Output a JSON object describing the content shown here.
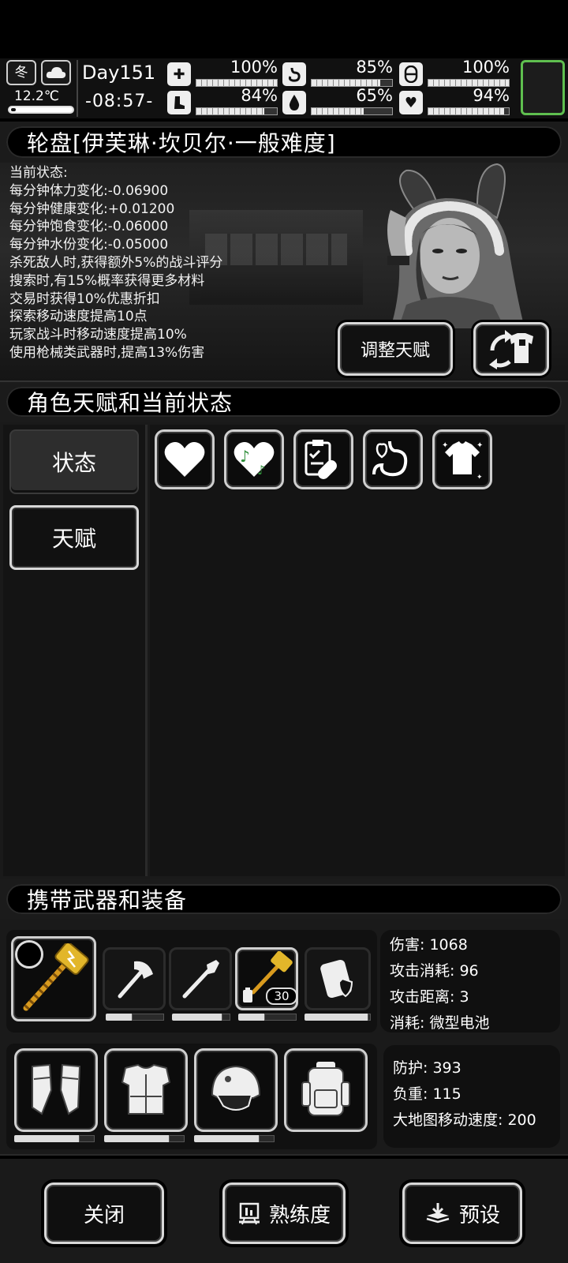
{
  "hud": {
    "season": "冬",
    "weather_icon": "cloud-icon",
    "temperature": "12.2℃",
    "day": "Day151",
    "time": "-08:57-",
    "stats": [
      {
        "name": "health",
        "icon": "medkit-icon",
        "value_text": "100%",
        "value": 100
      },
      {
        "name": "hunger",
        "icon": "stomach-icon",
        "value_text": "85%",
        "value": 85
      },
      {
        "name": "energy",
        "icon": "capsule-icon",
        "value_text": "100%",
        "value": 100
      },
      {
        "name": "stamina",
        "icon": "boot-icon",
        "value_text": "84%",
        "value": 84
      },
      {
        "name": "water",
        "icon": "water-drop-icon",
        "value_text": "65%",
        "value": 65
      },
      {
        "name": "mood",
        "icon": "heart-icon",
        "value_text": "94%",
        "value": 94
      }
    ],
    "accent_color": "#5fbf4f"
  },
  "character": {
    "title": "轮盘[伊芙琳·坎贝尔·一般难度]",
    "status_lines": [
      "当前状态:",
      "每分钟体力变化:-0.06900",
      "每分钟健康变化:+0.01200",
      "每分钟饱食变化:-0.06000",
      "每分钟水份变化:-0.05000",
      "杀死敌人时,获得额外5%的战斗评分",
      "搜索时,有15%概率获得更多材料",
      "交易时获得10%优惠折扣",
      "探索移动速度提高10点",
      "玩家战斗时移动速度提高10%",
      "使用枪械类武器时,提高13%伤害"
    ],
    "adjust_talent_label": "调整天赋",
    "outfit_icon": "swap-outfit-icon"
  },
  "talents": {
    "title": "角色天赋和当前状态",
    "tabs": [
      {
        "label": "状态",
        "selected": true
      },
      {
        "label": "天赋",
        "selected": false
      }
    ],
    "status_icons": [
      "heart-icon",
      "music-heart-icon",
      "medicine-icon",
      "stomach-icon",
      "shirt-icon"
    ]
  },
  "equipment": {
    "title": "携带武器和装备",
    "weapons": [
      {
        "name": "electric-hammer",
        "durability": 0
      },
      {
        "name": "axe",
        "durability": 0.45
      },
      {
        "name": "shovel",
        "durability": 0.85
      },
      {
        "name": "electric-hammer-2",
        "durability": 0.45,
        "ammo": "30"
      },
      {
        "name": "shield-box",
        "durability": 0.95
      }
    ],
    "weapon_stats": [
      "伤害: 1068",
      "攻击消耗: 96",
      "攻击距离: 3",
      "消耗: 微型电池"
    ],
    "armor": [
      {
        "name": "gauntlets",
        "durability": 0.8
      },
      {
        "name": "body-armor",
        "durability": 0.8
      },
      {
        "name": "helmet",
        "durability": 0.8
      },
      {
        "name": "backpack",
        "durability": null
      }
    ],
    "armor_stats": [
      "防护: 393",
      "负重: 115",
      "大地图移动速度: 200"
    ]
  },
  "buttons": {
    "close": "关闭",
    "proficiency": "熟练度",
    "preset": "预设"
  }
}
